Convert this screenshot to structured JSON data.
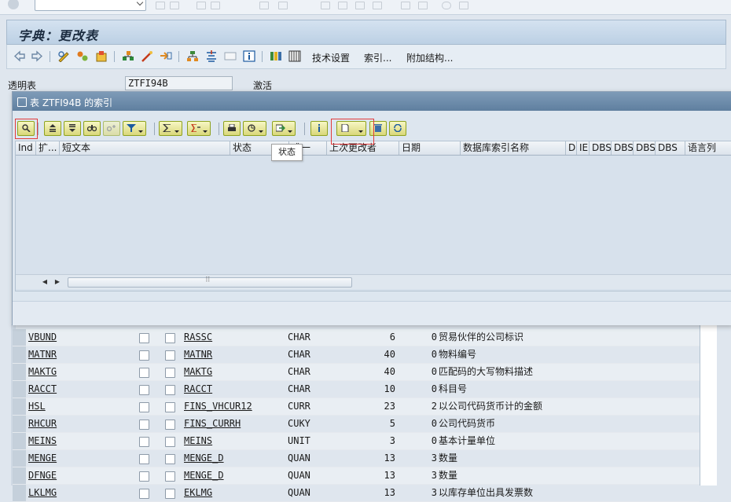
{
  "screen": {
    "title": "字典：更改表"
  },
  "toolbar": {
    "tech_settings": "技术设置",
    "index": "索引...",
    "append_structure": "附加结构..."
  },
  "form": {
    "transparent_table_label": "透明表",
    "table_name": "ZTFI94B",
    "status": "激活"
  },
  "dialog": {
    "title": "表 ZTFI94B 的索引",
    "columns": [
      "Ind",
      "扩...",
      "短文本",
      "状态",
      "唯一",
      "上次更改者",
      "日期",
      "数据库索引名称",
      "D",
      "IE",
      "DBS",
      "DBS",
      "DBS",
      "DBS",
      "语言列"
    ],
    "tooltip": "状态"
  },
  "fields": [
    {
      "name": "VBUND",
      "element": "RASSC",
      "type": "CHAR",
      "length": "6",
      "decimals": "0",
      "description": "贸易伙伴的公司标识"
    },
    {
      "name": "MATNR",
      "element": "MATNR",
      "type": "CHAR",
      "length": "40",
      "decimals": "0",
      "description": "物料编号"
    },
    {
      "name": "MAKTG",
      "element": "MAKTG",
      "type": "CHAR",
      "length": "40",
      "decimals": "0",
      "description": "匹配码的大写物料描述"
    },
    {
      "name": "RACCT",
      "element": "RACCT",
      "type": "CHAR",
      "length": "10",
      "decimals": "0",
      "description": "科目号"
    },
    {
      "name": "HSL",
      "element": "FINS_VHCUR12",
      "type": "CURR",
      "length": "23",
      "decimals": "2",
      "description": "以公司代码货币计的金额"
    },
    {
      "name": "RHCUR",
      "element": "FINS_CURRH",
      "type": "CUKY",
      "length": "5",
      "decimals": "0",
      "description": "公司代码货币"
    },
    {
      "name": "MEINS",
      "element": "MEINS",
      "type": "UNIT",
      "length": "3",
      "decimals": "0",
      "description": "基本计量单位"
    },
    {
      "name": "MENGE",
      "element": "MENGE_D",
      "type": "QUAN",
      "length": "13",
      "decimals": "3",
      "description": "数量"
    },
    {
      "name": "DFNGE",
      "element": "MENGE_D",
      "type": "QUAN",
      "length": "13",
      "decimals": "3",
      "description": "数量"
    },
    {
      "name": "LKLMG",
      "element": "EKLMG",
      "type": "QUAN",
      "length": "13",
      "decimals": "3",
      "description": "以库存单位出具发票数"
    }
  ]
}
